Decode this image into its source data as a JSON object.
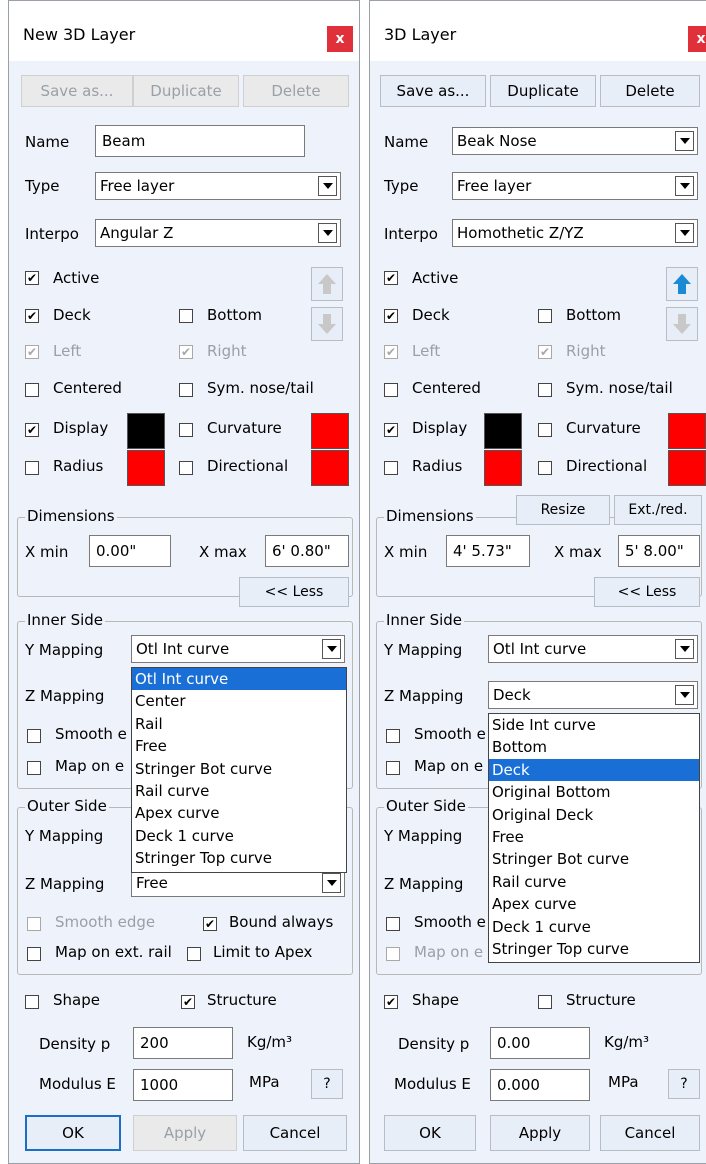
{
  "left": {
    "title": "New 3D Layer",
    "close": "x",
    "save_as": "Save as...",
    "duplicate": "Duplicate",
    "delete": "Delete",
    "name_label": "Name",
    "name_value": "Beam",
    "type_label": "Type",
    "type_value": "Free layer",
    "interpo_label": "Interpo",
    "interpo_value": "Angular Z",
    "active": "Active",
    "deck": "Deck",
    "bottom": "Bottom",
    "left": "Left",
    "right": "Right",
    "centered": "Centered",
    "sym": "Sym. nose/tail",
    "display": "Display",
    "curvature": "Curvature",
    "radius": "Radius",
    "directional": "Directional",
    "dimensions": "Dimensions",
    "xmin_label": "X min",
    "xmin": "0.00\"",
    "xmax_label": "X max",
    "xmax": "6' 0.80\"",
    "less": "<< Less",
    "inner": "Inner Side",
    "y_mapping": "Y Mapping",
    "y_value": "Otl Int curve",
    "z_mapping": "Z Mapping",
    "smooth_partial": "Smooth e",
    "mapon_partial": "Map on e",
    "dropdown": [
      "Otl Int curve",
      "Center",
      "Rail",
      "Free",
      "Stringer Bot curve",
      "Rail curve",
      "Apex curve",
      "Deck 1 curve",
      "Stringer Top curve"
    ],
    "dropdown_selected": 0,
    "outer": "Outer Side",
    "outer_y_mapping": "Y Mapping",
    "outer_z_mapping": "Z Mapping",
    "outer_z_value": "Free",
    "smooth_edge": "Smooth edge",
    "bound_always": "Bound always",
    "map_on_ext": "Map on ext. rail",
    "limit_apex": "Limit to Apex",
    "shape": "Shape",
    "structure": "Structure",
    "density_label": "Density p",
    "density": "200",
    "density_unit": "Kg/m³",
    "modulus_label": "Modulus E",
    "modulus": "1000",
    "modulus_unit": "MPa",
    "help": "?",
    "ok": "OK",
    "apply": "Apply",
    "cancel": "Cancel"
  },
  "right": {
    "title": "3D Layer",
    "close": "x",
    "save_as": "Save as...",
    "duplicate": "Duplicate",
    "delete": "Delete",
    "name_label": "Name",
    "name_value": "Beak Nose",
    "type_label": "Type",
    "type_value": "Free layer",
    "interpo_label": "Interpo",
    "interpo_value": "Homothetic Z/YZ",
    "active": "Active",
    "deck": "Deck",
    "bottom": "Bottom",
    "left": "Left",
    "right": "Right",
    "centered": "Centered",
    "sym": "Sym. nose/tail",
    "display": "Display",
    "curvature": "Curvature",
    "radius": "Radius",
    "directional": "Directional",
    "dimensions": "Dimensions",
    "resize": "Resize",
    "ext_red": "Ext./red.",
    "xmin_label": "X min",
    "xmin": "4' 5.73\"",
    "xmax_label": "X max",
    "xmax": "5' 8.00\"",
    "less": "<< Less",
    "inner": "Inner Side",
    "y_mapping": "Y Mapping",
    "y_value": "Otl Int curve",
    "z_mapping": "Z Mapping",
    "z_value": "Deck",
    "smooth_partial": "Smooth e",
    "mapon_partial": "Map on e",
    "dropdown": [
      "Side Int curve",
      "Bottom",
      "Deck",
      "Original Bottom",
      "Original Deck",
      "Free",
      "Stringer Bot curve",
      "Rail curve",
      "Apex curve",
      "Deck 1 curve",
      "Stringer Top curve"
    ],
    "dropdown_selected": 2,
    "outer": "Outer Side",
    "outer_y_mapping": "Y Mapping",
    "outer_z_mapping": "Z Mapping",
    "smooth_partial2": "Smooth e",
    "mapon_partial2": "Map on e",
    "shape": "Shape",
    "structure": "Structure",
    "density_label": "Density p",
    "density": "0.00",
    "density_unit": "Kg/m³",
    "modulus_label": "Modulus E",
    "modulus": "0.000",
    "modulus_unit": "MPa",
    "help": "?",
    "ok": "OK",
    "apply": "Apply",
    "cancel": "Cancel"
  },
  "colors": {
    "black": "#000000",
    "red": "#ff0000",
    "selected": "#1a6fd6",
    "arrow_blue": "#1a8ad4"
  }
}
